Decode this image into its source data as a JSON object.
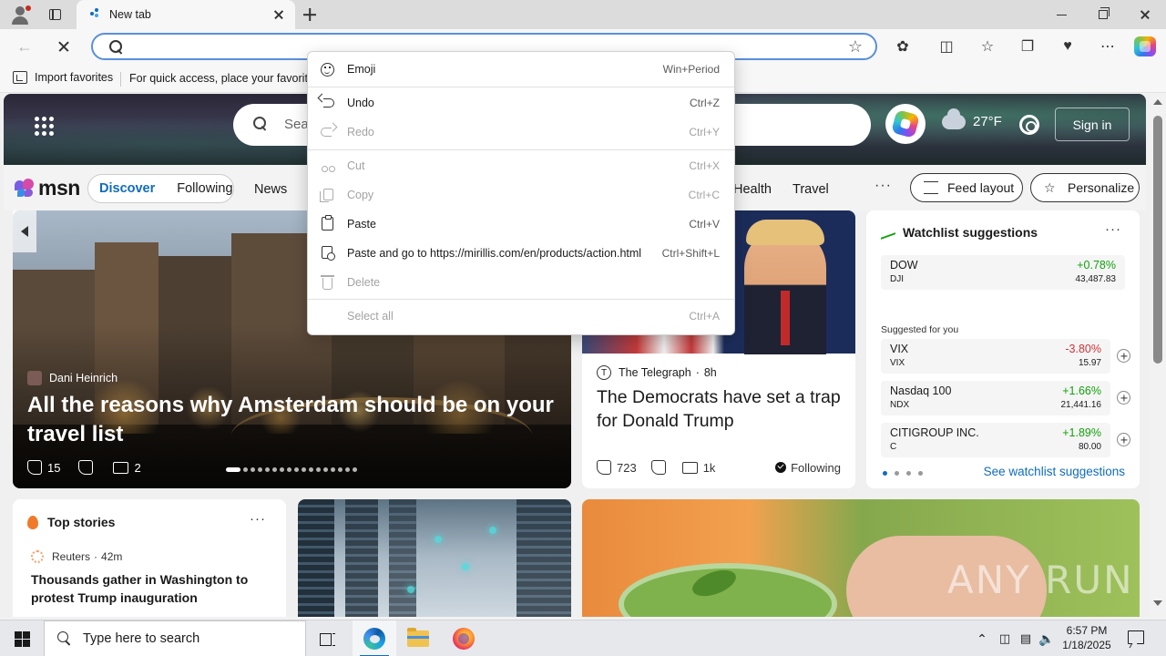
{
  "browser": {
    "tab_title": "New tab",
    "omnibox_value": "",
    "favorites_bar": {
      "import_label": "Import favorites",
      "hint": "For quick access, place your favorites"
    }
  },
  "context_menu": {
    "items": [
      {
        "label": "Emoji",
        "shortcut": "Win+Period",
        "enabled": true
      },
      {
        "label": "Undo",
        "shortcut": "Ctrl+Z",
        "enabled": true
      },
      {
        "label": "Redo",
        "shortcut": "Ctrl+Y",
        "enabled": false
      },
      {
        "label": "Cut",
        "shortcut": "Ctrl+X",
        "enabled": false
      },
      {
        "label": "Copy",
        "shortcut": "Ctrl+C",
        "enabled": false
      },
      {
        "label": "Paste",
        "shortcut": "Ctrl+V",
        "enabled": true
      },
      {
        "label": "Paste and go to https://mirillis.com/en/products/action.html",
        "shortcut": "Ctrl+Shift+L",
        "enabled": true
      },
      {
        "label": "Delete",
        "shortcut": "",
        "enabled": false
      },
      {
        "label": "Select all",
        "shortcut": "Ctrl+A",
        "enabled": false
      }
    ]
  },
  "msn": {
    "search_placeholder": "Sear",
    "weather": {
      "temp": "27°F",
      "icon": "cloud-icon"
    },
    "sign_in": "Sign in",
    "logo_text": "msn",
    "toggle": {
      "active": "Discover",
      "inactive": "Following"
    },
    "nav_links": [
      "News",
      "Health",
      "Travel"
    ],
    "nav_more": "···",
    "feed_layout": "Feed layout",
    "personalize": "Personalize",
    "hero": {
      "source": "Dani Heinrich",
      "title": "All the reasons why Amsterdam should be on your travel list",
      "likes": "15",
      "comments": "2"
    },
    "news": {
      "source": "The Telegraph",
      "time": "8h",
      "title": "The Democrats have set a trap for Donald Trump",
      "likes": "723",
      "comments": "1k",
      "following": "Following"
    },
    "watchlist": {
      "title": "Watchlist suggestions",
      "more": "···",
      "primary": {
        "name": "DOW",
        "ticker": "DJI",
        "change": "+0.78%",
        "value": "43,487.83",
        "color": "#13a10e"
      },
      "suggested_label": "Suggested for you",
      "suggested": [
        {
          "name": "VIX",
          "ticker": "VIX",
          "change": "-3.80%",
          "value": "15.97",
          "color": "#d13438"
        },
        {
          "name": "Nasdaq 100",
          "ticker": "NDX",
          "change": "+1.66%",
          "value": "21,441.16",
          "color": "#13a10e"
        },
        {
          "name": "CITIGROUP INC.",
          "ticker": "C",
          "change": "+1.89%",
          "value": "80.00",
          "color": "#13a10e"
        }
      ],
      "link": "See watchlist suggestions"
    },
    "top_stories": {
      "title": "Top stories",
      "more": "···",
      "source": "Reuters",
      "time": "42m",
      "headline": "Thousands gather in Washington to protest Trump inauguration"
    },
    "watermark": "ANY RUN"
  },
  "taskbar": {
    "search_placeholder": "Type here to search",
    "time": "6:57 PM",
    "date": "1/18/2025"
  },
  "colors": {
    "accent": "#0f6cbd",
    "positive": "#13a10e",
    "negative": "#d13438"
  }
}
